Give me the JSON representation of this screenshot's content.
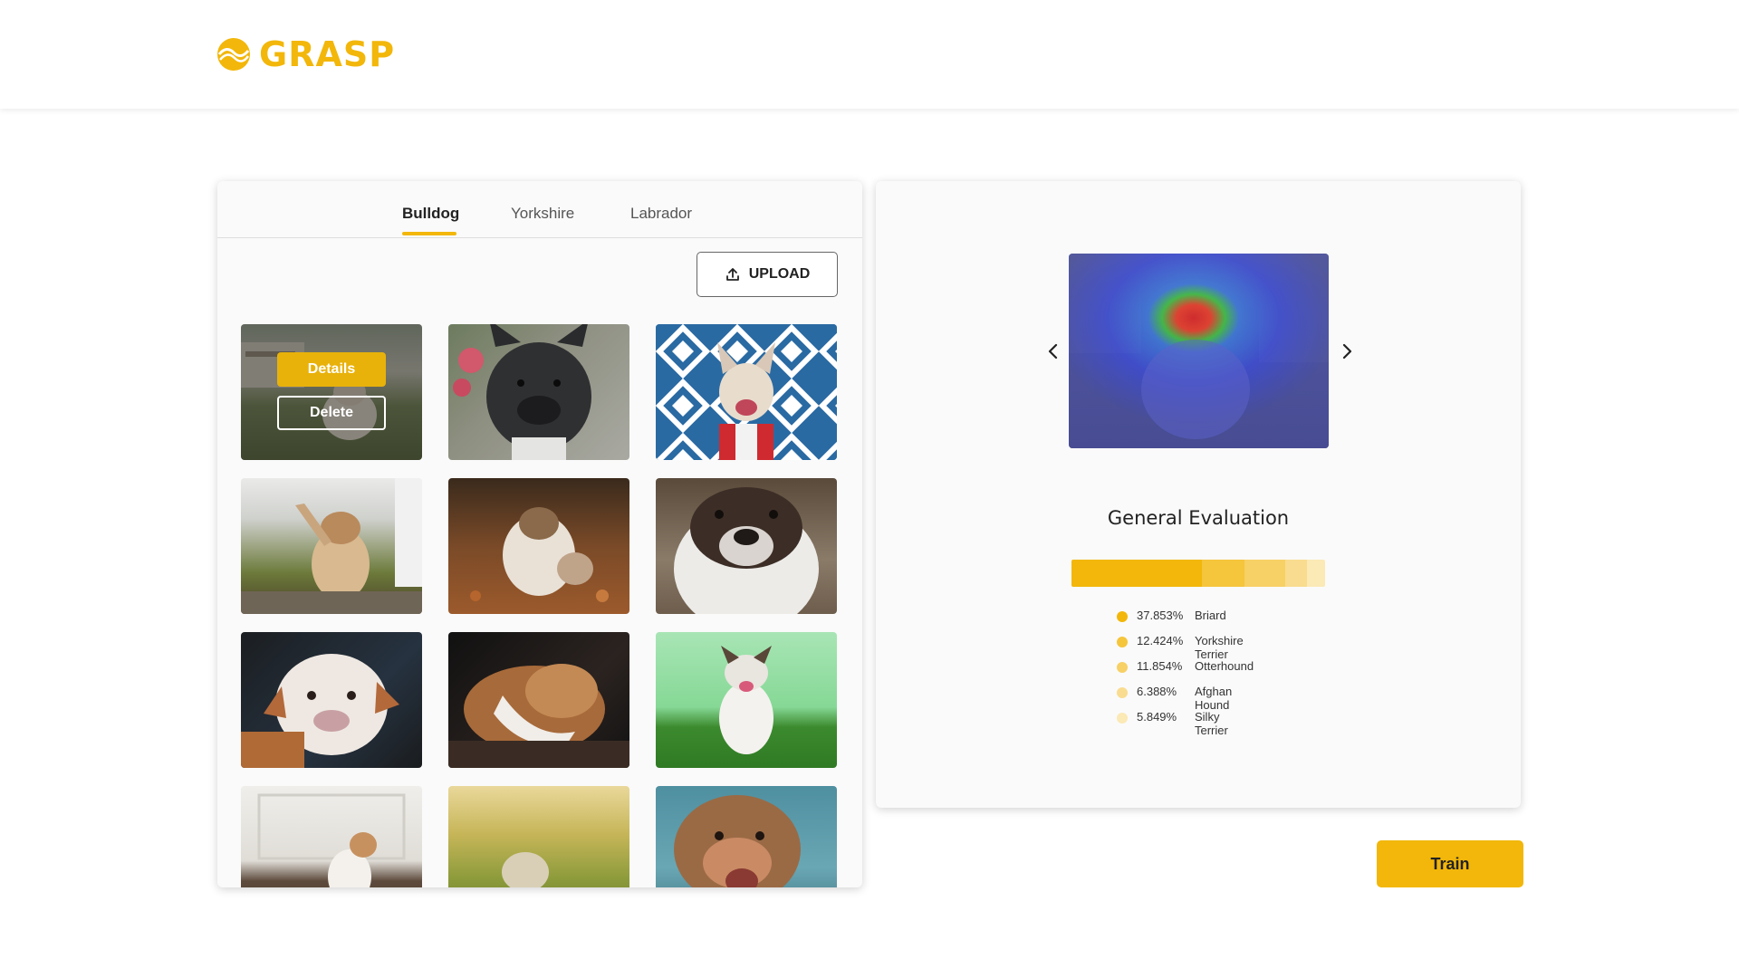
{
  "app": {
    "brand": "GRASP",
    "brand_color": "#f2b70a"
  },
  "tabs": [
    {
      "label": "Bulldog",
      "active": true
    },
    {
      "label": "Yorkshire",
      "active": false
    },
    {
      "label": "Labrador",
      "active": false
    }
  ],
  "gallery": {
    "upload_label": "UPLOAD",
    "upload_icon": "upload-icon",
    "hover_actions": {
      "details_label": "Details",
      "delete_label": "Delete"
    },
    "images": [
      {
        "name": "bulldog-yard"
      },
      {
        "name": "french-bulldog-black"
      },
      {
        "name": "french-bulldog-tiles"
      },
      {
        "name": "bulldog-raising-paw"
      },
      {
        "name": "bulldog-autumn-leaves"
      },
      {
        "name": "bulldog-face-closeup"
      },
      {
        "name": "bulldog-puppy-couch"
      },
      {
        "name": "bulldog-lying-dark"
      },
      {
        "name": "bulldog-grass-green"
      },
      {
        "name": "bulldog-indoor-floor"
      },
      {
        "name": "bulldog-field-sunset"
      },
      {
        "name": "bulldog-tongue-sky"
      }
    ]
  },
  "evaluation": {
    "title": "General Evaluation",
    "prev_icon": "chevron-left-icon",
    "next_icon": "chevron-right-icon",
    "predictions": [
      {
        "value": "37.853%",
        "label": "Briard",
        "pct": 37.853,
        "color": "#f2b70a"
      },
      {
        "value": "12.424%",
        "label": "Yorkshire Terrier",
        "pct": 12.424,
        "color": "#f5c53c"
      },
      {
        "value": "11.854%",
        "label": "Otterhound",
        "pct": 11.854,
        "color": "#f7d066"
      },
      {
        "value": "6.388%",
        "label": "Afghan Hound",
        "pct": 6.388,
        "color": "#f9dc8f"
      },
      {
        "value": "5.849%",
        "label": "Silky Terrier",
        "pct": 5.849,
        "color": "#fbe9b6"
      }
    ]
  },
  "actions": {
    "train_label": "Train"
  }
}
